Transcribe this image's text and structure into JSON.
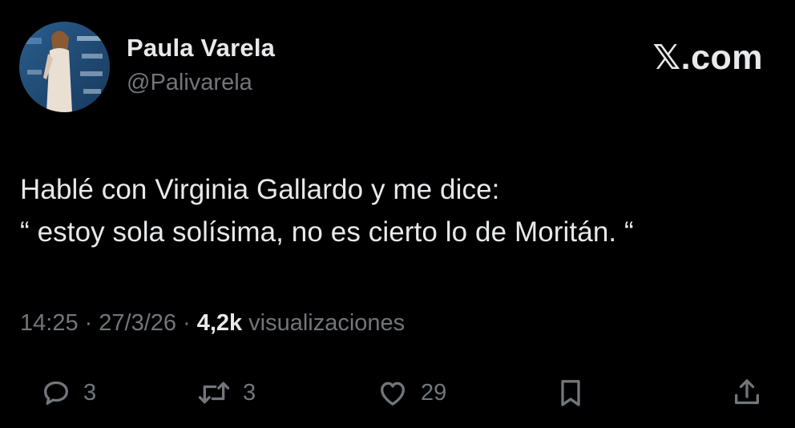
{
  "author": {
    "display_name": "Paula Varela",
    "handle": "@Palivarela"
  },
  "brand": {
    "x_mark": "𝕏",
    "label": ".com"
  },
  "tweet": {
    "lines": [
      "Hablé con Virginia Gallardo y me dice:",
      "“ estoy sola solísima, no es cierto lo de Moritán. “"
    ]
  },
  "meta": {
    "time": "14:25",
    "date": "27/3/26",
    "separator": "·",
    "views_count": "4,2k",
    "views_label": "visualizaciones"
  },
  "actions": {
    "reply": {
      "icon": "reply-icon",
      "count": "3"
    },
    "retweet": {
      "icon": "retweet-icon",
      "count": "3"
    },
    "like": {
      "icon": "heart-icon",
      "count": "29"
    },
    "bookmark": {
      "icon": "bookmark-icon"
    },
    "share": {
      "icon": "share-icon"
    }
  },
  "colors": {
    "background": "#000000",
    "primary_text": "#e7e9ea",
    "secondary_text": "#71767b"
  }
}
